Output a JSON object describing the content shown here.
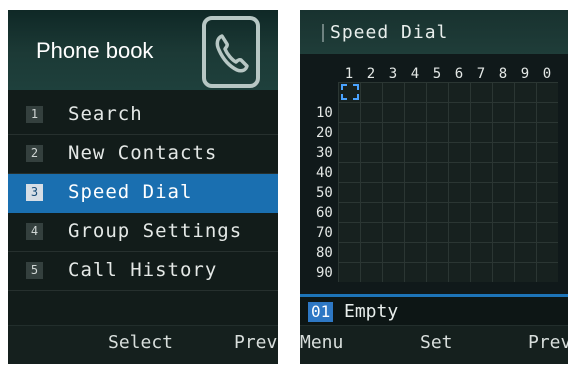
{
  "phonebook": {
    "title": "Phone book",
    "items": [
      {
        "num": "1",
        "label": "Search"
      },
      {
        "num": "2",
        "label": "New Contacts"
      },
      {
        "num": "3",
        "label": "Speed Dial"
      },
      {
        "num": "4",
        "label": "Group Settings"
      },
      {
        "num": "5",
        "label": "Call History"
      }
    ],
    "selected_index": 2,
    "softkeys": {
      "center": "Select",
      "right": "Prev"
    }
  },
  "speed_dial": {
    "title": "Speed Dial",
    "column_headers": [
      "1",
      "2",
      "3",
      "4",
      "5",
      "6",
      "7",
      "8",
      "9",
      "0"
    ],
    "row_headers": [
      "10",
      "20",
      "30",
      "40",
      "50",
      "60",
      "70",
      "80",
      "90"
    ],
    "selected_slot": "01",
    "selected_value": "Empty",
    "softkeys": {
      "left": "Menu",
      "center": "Set",
      "right": "Prev"
    }
  }
}
